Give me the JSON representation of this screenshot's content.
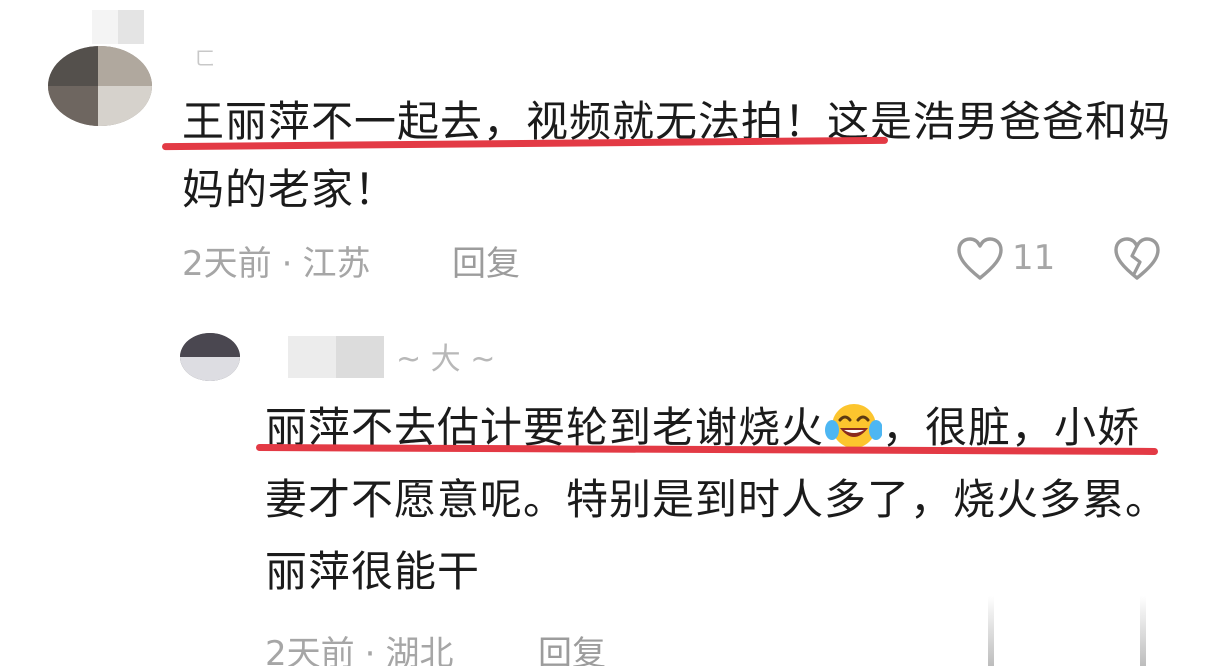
{
  "comment": {
    "username": "ㄈ",
    "text": "王丽萍不一起去，视频就无法拍！这是浩男爸爸和妈妈的老家！",
    "time": "2天前",
    "separator": "·",
    "location": "江苏",
    "reply_label": "回复",
    "like_count": "11"
  },
  "reply": {
    "username": "~ 大 ~",
    "text_before_emoji": "丽萍不去估计要轮到老谢烧火",
    "text_after_emoji": "，很脏，小娇妻才不愿意呢。特别是到时人多了，烧火多累。丽萍很能干",
    "time": "2天前",
    "separator": "·",
    "location": "湖北",
    "reply_label": "回复"
  },
  "icons": {
    "like": "heart-outline-icon",
    "dislike": "broken-heart-icon",
    "emoji": "laughing-crying-emoji-icon"
  },
  "colors": {
    "annotation_red": "#e33a45",
    "meta_gray": "#a6a6a6",
    "text": "#1b1b1b"
  }
}
